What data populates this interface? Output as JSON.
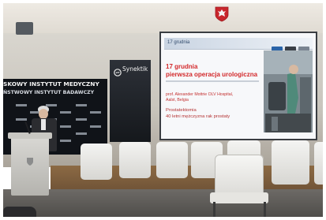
{
  "banner": {
    "line1": "SKOWY INSTYTUT MEDYCZNY",
    "line2": "ŃSTWOWY INSTYTUT BADAWCZY"
  },
  "sign": {
    "brand": "Synektik"
  },
  "slide": {
    "header_strip": "17 grudnia",
    "title_line1": "17 grudnia",
    "title_line2": "pierwsza operacja urologiczna",
    "presenter_line1": "prof. Alexander Mottrie OLV Hospital,",
    "presenter_line2": "Aalst, Belgia",
    "topic_line1": "Prostatektomia",
    "topic_line2": "40 letni mężczyzna rak prostaty"
  },
  "colors": {
    "slide_accent": "#d3292b",
    "banner_bg": "#101318",
    "stage_wood": "#8c6a44"
  }
}
